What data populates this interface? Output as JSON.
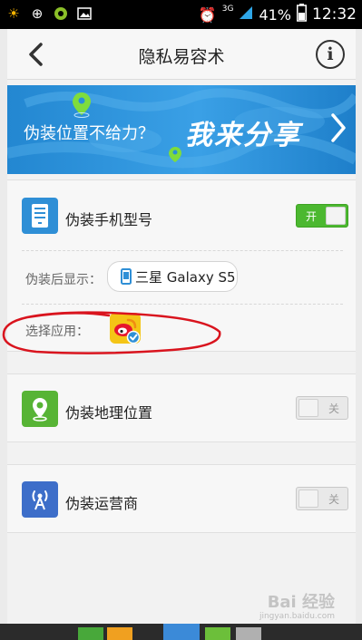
{
  "statusbar": {
    "network": "3G",
    "battery": "41%",
    "time": "12:32"
  },
  "header": {
    "title": "隐私易容术"
  },
  "banner": {
    "text": "伪装位置不给力？",
    "cta": "我来分享"
  },
  "phone_model": {
    "label": "伪装手机型号",
    "toggle": "开",
    "display_label": "伪装后显示：",
    "device": "三星 Galaxy S5",
    "select_app_label": "选择应用："
  },
  "location": {
    "label": "伪装地理位置",
    "toggle": "关"
  },
  "carrier": {
    "label": "伪装运营商",
    "toggle": "关"
  },
  "watermark": {
    "text": "Bai 经验",
    "sub": "jingyan.baidu.com"
  },
  "colors": {
    "accent_green": "#4cb830",
    "banner_blue": "#2a8fd8",
    "annotation_red": "#d9141e"
  }
}
